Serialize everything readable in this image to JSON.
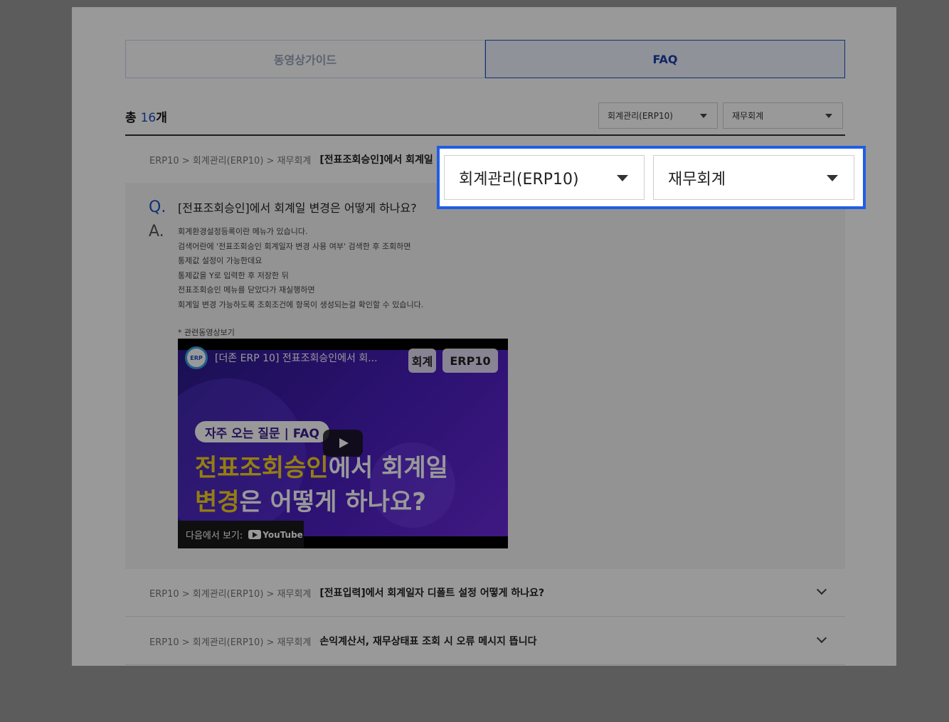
{
  "tabs": [
    {
      "label": "동영상가이드"
    },
    {
      "label": "FAQ"
    }
  ],
  "total": {
    "prefix": "총",
    "count": "16",
    "suffix": "개"
  },
  "filters": {
    "category": "회계관리(ERP10)",
    "subcategory": "재무회계"
  },
  "faq_items": [
    {
      "crumb": "ERP10 > 회계관리(ERP10) > 재무회계",
      "title": "[전표조회승인]에서 회계일"
    },
    {
      "crumb": "ERP10 > 회계관리(ERP10) > 재무회계",
      "title": "[전표입력]에서 회계일자 디폴트 설정 어떻게 하나요?"
    },
    {
      "crumb": "ERP10 > 회계관리(ERP10) > 재무회계",
      "title": "손익계산서, 재무상태표 조회 시 오류 메시지 뜹니다"
    }
  ],
  "answer": {
    "q_mark": "Q.",
    "question": "[전표조회승인]에서 회계일 변경은 어떻게 하나요?",
    "a_mark": "A.",
    "lines": [
      "회계환경설정등록이란 메뉴가 있습니다.",
      "검색어란에 '전표조회승인 회계일자 변경 사용 여부' 검색한 후 조회하면",
      "통제값 설정이 가능한데요",
      "통제값을 Y로 입력한 후 저장한 뒤",
      "전표조회승인 메뉴를 닫았다가 재실행하면",
      "회계일 변경 가능하도록 조회조건에 항목이 생성되는걸 확인할 수 있습니다."
    ],
    "related": "* 관련동영상보기"
  },
  "video": {
    "channel_logo": "ERP",
    "title": "[더존 ERP 10] 전표조회승인에서 회...",
    "btn1": "회계",
    "btn2": "ERP10",
    "pill": "자주 오는 질문 | FAQ",
    "line1_yellow": "전표조회승인",
    "line1_white": "에서 회계일",
    "line2_yellow": "변경",
    "line2_white": "은 어떻게 하나요?",
    "watch_on": "다음에서 보기:",
    "youtube": "YouTube"
  },
  "colors": {
    "accent": "#1d4fc4",
    "highlight": "#1f5de6",
    "overlay": "#9a9a9a"
  }
}
